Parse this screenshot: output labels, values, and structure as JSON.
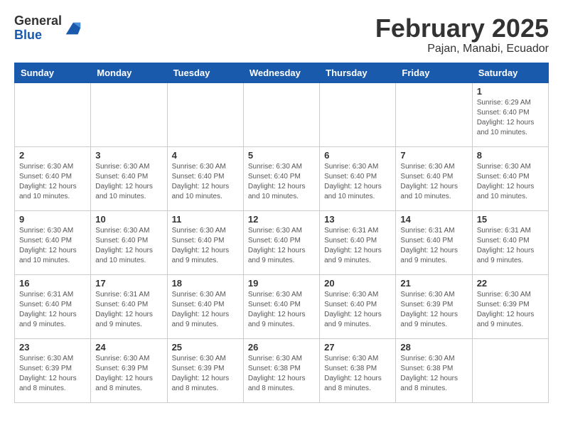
{
  "header": {
    "logo": {
      "general": "General",
      "blue": "Blue"
    },
    "title": "February 2025",
    "subtitle": "Pajan, Manabi, Ecuador"
  },
  "calendar": {
    "days_of_week": [
      "Sunday",
      "Monday",
      "Tuesday",
      "Wednesday",
      "Thursday",
      "Friday",
      "Saturday"
    ],
    "weeks": [
      [
        {
          "day": "",
          "info": ""
        },
        {
          "day": "",
          "info": ""
        },
        {
          "day": "",
          "info": ""
        },
        {
          "day": "",
          "info": ""
        },
        {
          "day": "",
          "info": ""
        },
        {
          "day": "",
          "info": ""
        },
        {
          "day": "1",
          "info": "Sunrise: 6:29 AM\nSunset: 6:40 PM\nDaylight: 12 hours and 10 minutes."
        }
      ],
      [
        {
          "day": "2",
          "info": "Sunrise: 6:30 AM\nSunset: 6:40 PM\nDaylight: 12 hours and 10 minutes."
        },
        {
          "day": "3",
          "info": "Sunrise: 6:30 AM\nSunset: 6:40 PM\nDaylight: 12 hours and 10 minutes."
        },
        {
          "day": "4",
          "info": "Sunrise: 6:30 AM\nSunset: 6:40 PM\nDaylight: 12 hours and 10 minutes."
        },
        {
          "day": "5",
          "info": "Sunrise: 6:30 AM\nSunset: 6:40 PM\nDaylight: 12 hours and 10 minutes."
        },
        {
          "day": "6",
          "info": "Sunrise: 6:30 AM\nSunset: 6:40 PM\nDaylight: 12 hours and 10 minutes."
        },
        {
          "day": "7",
          "info": "Sunrise: 6:30 AM\nSunset: 6:40 PM\nDaylight: 12 hours and 10 minutes."
        },
        {
          "day": "8",
          "info": "Sunrise: 6:30 AM\nSunset: 6:40 PM\nDaylight: 12 hours and 10 minutes."
        }
      ],
      [
        {
          "day": "9",
          "info": "Sunrise: 6:30 AM\nSunset: 6:40 PM\nDaylight: 12 hours and 10 minutes."
        },
        {
          "day": "10",
          "info": "Sunrise: 6:30 AM\nSunset: 6:40 PM\nDaylight: 12 hours and 10 minutes."
        },
        {
          "day": "11",
          "info": "Sunrise: 6:30 AM\nSunset: 6:40 PM\nDaylight: 12 hours and 9 minutes."
        },
        {
          "day": "12",
          "info": "Sunrise: 6:30 AM\nSunset: 6:40 PM\nDaylight: 12 hours and 9 minutes."
        },
        {
          "day": "13",
          "info": "Sunrise: 6:31 AM\nSunset: 6:40 PM\nDaylight: 12 hours and 9 minutes."
        },
        {
          "day": "14",
          "info": "Sunrise: 6:31 AM\nSunset: 6:40 PM\nDaylight: 12 hours and 9 minutes."
        },
        {
          "day": "15",
          "info": "Sunrise: 6:31 AM\nSunset: 6:40 PM\nDaylight: 12 hours and 9 minutes."
        }
      ],
      [
        {
          "day": "16",
          "info": "Sunrise: 6:31 AM\nSunset: 6:40 PM\nDaylight: 12 hours and 9 minutes."
        },
        {
          "day": "17",
          "info": "Sunrise: 6:31 AM\nSunset: 6:40 PM\nDaylight: 12 hours and 9 minutes."
        },
        {
          "day": "18",
          "info": "Sunrise: 6:30 AM\nSunset: 6:40 PM\nDaylight: 12 hours and 9 minutes."
        },
        {
          "day": "19",
          "info": "Sunrise: 6:30 AM\nSunset: 6:40 PM\nDaylight: 12 hours and 9 minutes."
        },
        {
          "day": "20",
          "info": "Sunrise: 6:30 AM\nSunset: 6:40 PM\nDaylight: 12 hours and 9 minutes."
        },
        {
          "day": "21",
          "info": "Sunrise: 6:30 AM\nSunset: 6:39 PM\nDaylight: 12 hours and 9 minutes."
        },
        {
          "day": "22",
          "info": "Sunrise: 6:30 AM\nSunset: 6:39 PM\nDaylight: 12 hours and 9 minutes."
        }
      ],
      [
        {
          "day": "23",
          "info": "Sunrise: 6:30 AM\nSunset: 6:39 PM\nDaylight: 12 hours and 8 minutes."
        },
        {
          "day": "24",
          "info": "Sunrise: 6:30 AM\nSunset: 6:39 PM\nDaylight: 12 hours and 8 minutes."
        },
        {
          "day": "25",
          "info": "Sunrise: 6:30 AM\nSunset: 6:39 PM\nDaylight: 12 hours and 8 minutes."
        },
        {
          "day": "26",
          "info": "Sunrise: 6:30 AM\nSunset: 6:38 PM\nDaylight: 12 hours and 8 minutes."
        },
        {
          "day": "27",
          "info": "Sunrise: 6:30 AM\nSunset: 6:38 PM\nDaylight: 12 hours and 8 minutes."
        },
        {
          "day": "28",
          "info": "Sunrise: 6:30 AM\nSunset: 6:38 PM\nDaylight: 12 hours and 8 minutes."
        },
        {
          "day": "",
          "info": ""
        }
      ]
    ]
  }
}
